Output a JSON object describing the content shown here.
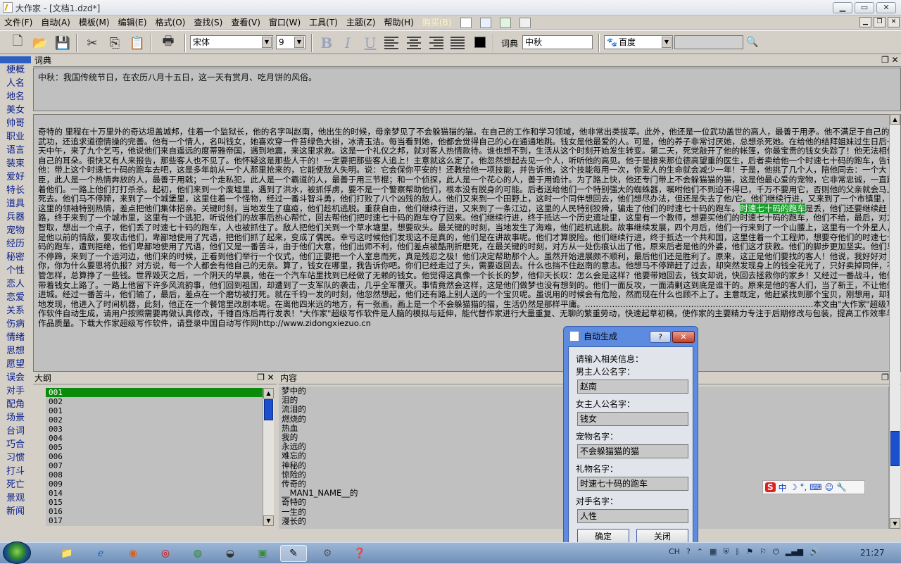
{
  "window": {
    "title": "大作家 - [文档1.dzd*]",
    "min_icon": "minimize-icon",
    "max_icon": "maximize-icon",
    "close_icon": "close-icon"
  },
  "menu": {
    "items": [
      "文件(F)",
      "自动(A)",
      "模板(M)",
      "编辑(E)",
      "格式(O)",
      "查找(S)",
      "查看(V)",
      "窗口(W)",
      "工具(T)",
      "主题(Z)",
      "帮助(H)",
      "购买(B)"
    ],
    "swatches": [
      "#ffffff",
      "#e8f0ff",
      "#e0f5e0",
      "#f0f0f0"
    ],
    "accent_color": "#fff7c0"
  },
  "toolbar": {
    "font_name": "宋体",
    "font_size": "9",
    "bold": "B",
    "italic": "I",
    "underline": "U",
    "dict_label": "词典",
    "dict_value": "中秋",
    "search_engine": "百度",
    "search_value": ""
  },
  "sidebar": {
    "items": [
      "梗概",
      "人名",
      "地名",
      "美女",
      "帅哥",
      "职业",
      "语言",
      "装束",
      "爱好",
      "特长",
      "道具",
      "兵器",
      "宠物",
      "经历",
      "秘密",
      "个性",
      "恋人",
      "恋爱",
      "关系",
      "伤病",
      "情绪",
      "思想",
      "愿望",
      "误会",
      "对手",
      "配角",
      "场景",
      "台词",
      "巧合",
      "习惯",
      "打斗",
      "死亡",
      "景观",
      "新闻"
    ]
  },
  "dict_panel": {
    "title": "词典",
    "text": "中秋：我国传统节日，在农历八月十五日，这一天有赏月、吃月饼的风俗。"
  },
  "doc": {
    "before": "奇特的 里程在十万里外的奇达坦盖城邦，住着一个监狱长，他的名字叫赵南，他出生的时候，母亲梦见了不会躲猫猫的猫。在自己的工作和学习领域，他非常出类拔萃。此外，他还是一位武功盖世的高人，最善于用矛。他不满足于自己的武功，还追求道德情操的完善。他有一个情人，名叫钱女，她喜欢穿一件苔绿色大褂，冰清玉洁。每当看到她，他都会觉得自己的心在通通地跳。钱女是他最爱的人。可是，他的养子非常讨厌她，总想杀死她。在给他的结拜姐妹过生日后一天中午，来了九个乞丐，他说他们来自遥远的度蒂雅帝国，遇到地震，来这里求救。这是一个礼仪之邦，就对客人热情款待。谁也想不到，生活从这个时刻开始发生转变。第二天，死党敲开了他的帐篷，你最宝贵的钱女失踪了！他无法相信自己的耳朵。很快又有人来报告，那些客人也不见了。他怀疑这是那些人干的！一定要把那些客人追上！主意就这么定了。他忽然想起去见一个人，听听他的高见。他于是接来那位德高望重的医生，后者卖给他一个时速七十码的跑车，告诉他：带上这个时速七十码的跑车去吧，这是多年前从一个人那里抢来的，它能使敌人失明。说：它会保你平安的！还教给他一项技能，并告诉他，这个技能每用一次，你爱人的生命就会减少一年！于是，他挑了几个人，陪他同去：一个大臣，此人是一个热情奔放的人，最善于用戟；一个走私犯，此人是一个霸道的人，最善于用三节棍；和一个侦探，此人是一个花心的人，善于用诡计。为了路上快，他还专门带上不会躲猫猫的猫，这是他最心爱的宠物，它非常忠诚，一直跟着他们。一路上他们打打杀杀。起初，他们来到一个废墟里，遇到了洪水，被抓俘虏，要不是一个警察帮助他们，根本没有脱身的可能。后者送给他们一个特别强大的蜘蛛器，嘱咐他们不到迫不得已，千万不要用它，否则他的父亲就会马上死去。他们马不停蹄，来到了一个城堡里，这里住着一个怪物，经过一番斗智斗勇，他们打败了八个凶残的敌人。他们又来到一个田野上，这时一个同伴想回去，他们想尽办法，但还是失去了他/它。他们继续行进，又来到了一个市镇里，这里的领袖特别热情，差点把他们集体招亲。关键时刻，当地发生了瘟疫，他们趁机逃脱。重获自由，他们继续行进，又来到了一条江边，这里的人民特别狡猾，骗走了他们的时速七十码的跑车。",
    "highlight": "时速七十码的跑车",
    "after": "是丢，他们还要继续赶路，终于来到了一个城市里，这里有一个逃犯，听说他们的故事后热心帮忙，回去帮他们把时速七十码的跑车夺了回来。他们继续行进，终于抵达一个历史遗址里，这里有一个教师，想要买他们的时速七十码的跑车，他们不给，最后，对方智取，想出一个点子，他们丢了时速七十码的跑车，人也被抓住了。敌人把他们关到一个草水塘里，想要砍头。最关键的时刻，当地发生了海难，他们趁机逃脱。故事继续发展，四个月后，他们一行来到了一个山腰上，这里有一个外星人，是他以前的情敌，要攻击他们，卑鄙地使用了咒语，把他们抓了起来，变成了儒民。幸亏这时候他们发现这不是真的，他们是在讲故事呢。他们才算脱险。他们继续行进，终于抵达一个共和国，这里住着一个工程师，想要夺他们的时速七十码的跑车，遭到拒绝，他们卑鄙地使用了咒语，他们又是一番苦斗，由于他们大意，他们出师不利，他们差点被酷刑折磨死，在最关键的时刻，对方从一处伤痕认出了他，原来后者是他的外婆，他们这才获救。他们的脚步更加坚实。他们马不停蹄，来到了一个运河边，他们来的时候，正看到他们举行一个仪式，他们正要把一个人室息而死，真是残忍之极！他们决定帮助那个人。虽然开始进展颇不顺利，最后他们还是胜利了。原来，这正是他们要找的客人！他说，我好好对你，你为什么要恩将仇报？对方说，每一个人都会有他自己的无奈。算了，钱女在哪里，我告诉你吧。你们已经走过了头，需要返回去。什么也挡不住赵南的意志。他想马不停蹄赶了过去，却突然发现身上的钱全花光了，只好卖掉同伴，不管怎样，总算挣了一些钱。世界毁灭之后，一个阴天的早晨，他在一个汽车站里找到已经做了无赖的钱女。他觉得这真像一个长长的梦，他仰天长叹：怎么会是这样？他要带她回去，钱女却说，快回去拯救你的家乡！又经过一番战斗，他们带着钱女上路了。一路上他留下许多风流韵事，他们回到祖国，却遭到了一支军队的袭击，几乎全军覆灭。事情竟然会这样，这是他们做梦也没有想到的。他们一面反攻，一面清剿这到底是谁干的。原来是他的客人们，当了新王，不让他们进城。经过一番苦斗，他们输了，最后，差点在一个磨坊被打死。就在千钧一发的时刻，他忽然想起，他们还有路上别人送的一个宝贝呢。虽说用的时候会有危险，然而现在什么也顾不上了。主意既定，他赶紧找到那个宝贝，刚想用，却猛地发现，他进入了时间机器，此刻，他正在一个餐馆里改剧本呢。在离他四米远的地方，有一张画，画上是一个不会躲猫猫的猫，生活仍然是那样平庸。…………………………………………………………………………本文由\"大作家\"超级写作软件自动生成，请用户按照需要再做认真修改，千锤百炼后再行发表！\"大作家\"超级写作软件是人脑的模拟与延伸，能代替作家进行大量重复、无聊的繁重劳动，快速起草初稿，使作家的主要精力专注于后期修改与包装，提高工作效率与作品质量。下载大作家超级写作软件，请登录中国自动写作网http://www.zidongxiezuo.cn"
  },
  "outline_panel": {
    "title": "大纲",
    "items": [
      "001",
      "002",
      "001",
      "002",
      "003",
      "004",
      "005",
      "006",
      "007",
      "008",
      "009",
      "014",
      "015",
      "016",
      "017"
    ],
    "selected_index": 0
  },
  "content_panel": {
    "title": "内容",
    "items": [
      "梦中的",
      "泪的",
      "流泪的",
      "燃烧的",
      "热血",
      "我的",
      "永远的",
      "难忘的",
      "神秘的",
      "惊险的",
      "传奇的",
      "__MAN1_NAME__的",
      "奇特的",
      "一生的",
      "漫长的"
    ]
  },
  "dialog": {
    "title": "自动生成",
    "prompt": "请输入相关信息：",
    "fields": [
      {
        "label": "男主人公名字：",
        "value": "赵南"
      },
      {
        "label": "女主人公名字：",
        "value": "钱女"
      },
      {
        "label": "宠物名字：",
        "value": "不会躲猫猫的猫"
      },
      {
        "label": "礼物名字：",
        "value": "时速七十码的跑车"
      },
      {
        "label": "对手名字：",
        "value": "人性"
      }
    ],
    "ok_label": "确定",
    "cancel_label": "关闭",
    "help_label": "?",
    "close_label": "✕"
  },
  "ime": {
    "logo": "S",
    "mode": "中"
  },
  "taskbar": {
    "apps": [
      "folder-icon",
      "ie-icon",
      "firefox-icon",
      "opera-icon",
      "chrome-icon",
      "disk-icon",
      "app-icon",
      "writer-icon",
      "tool-icon",
      "help-icon"
    ],
    "tray_lang": "CH",
    "clock": "21:27"
  }
}
